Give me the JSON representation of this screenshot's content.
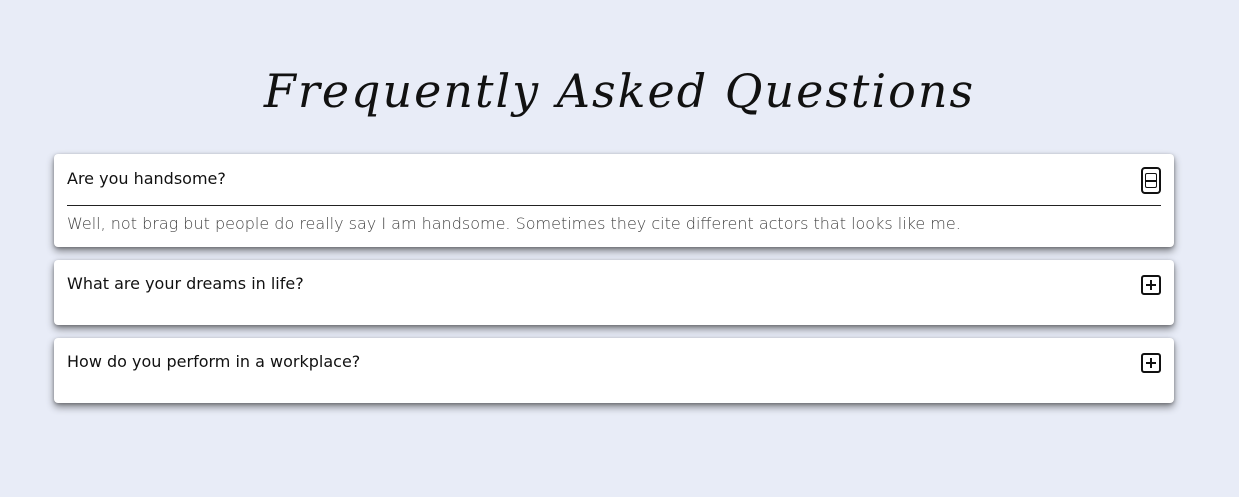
{
  "page": {
    "title": "Frequently Asked Questions"
  },
  "faq": {
    "items": [
      {
        "question": "Are you handsome?",
        "answer": "Well, not brag but people do really say I am handsome. Sometimes they cite different actors that looks like me.",
        "expanded": true,
        "toggle_icon": "minus-square-icon"
      },
      {
        "question": "What are your dreams in life?",
        "expanded": false,
        "toggle_icon": "plus-square-icon"
      },
      {
        "question": "How do you perform in a workplace?",
        "expanded": false,
        "toggle_icon": "plus-square-icon"
      }
    ]
  },
  "colors": {
    "background": "#e8ecf7",
    "card": "#ffffff",
    "text": "#111111",
    "answer_text": "#444444"
  }
}
